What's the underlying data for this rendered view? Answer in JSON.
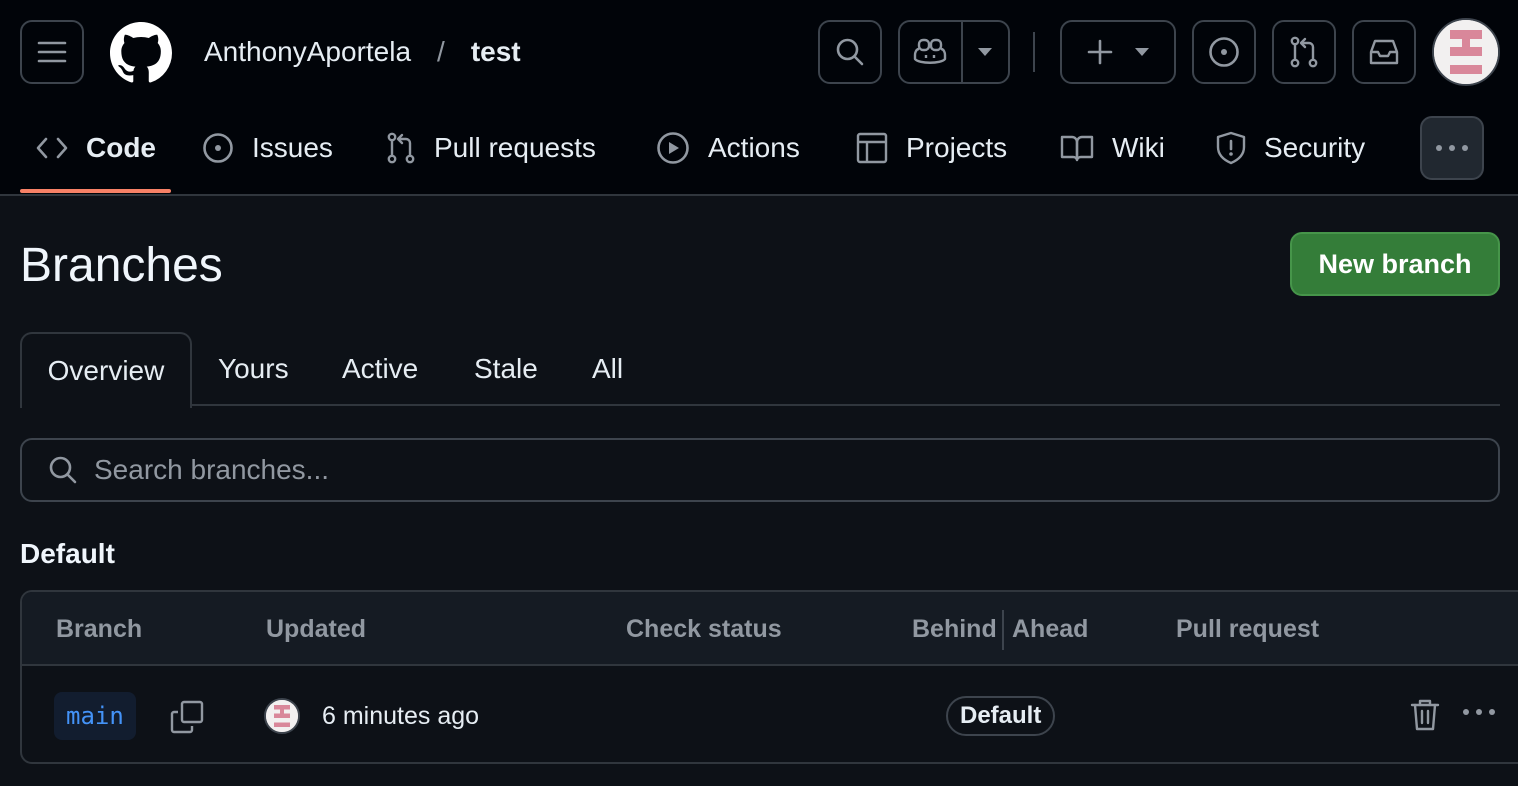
{
  "header": {
    "owner": "AnthonyAportela",
    "separator": "/",
    "repo": "test",
    "icons": [
      "hamburger-menu-icon",
      "github-logo-icon",
      "search-icon",
      "copilot-icon",
      "triangle-down-icon",
      "plus-icon",
      "issue-opened-icon",
      "git-pull-request-icon",
      "inbox-icon"
    ]
  },
  "nav": {
    "code": "Code",
    "issues": "Issues",
    "pull_requests": "Pull requests",
    "actions": "Actions",
    "projects": "Projects",
    "wiki": "Wiki",
    "security": "Security"
  },
  "main": {
    "title": "Branches",
    "new_branch": "New branch",
    "tabs": [
      "Overview",
      "Yours",
      "Active",
      "Stale",
      "All"
    ],
    "search_placeholder": "Search branches...",
    "section": "Default"
  },
  "table": {
    "columns": {
      "branch": "Branch",
      "updated": "Updated",
      "check_status": "Check status",
      "behind": "Behind",
      "ahead": "Ahead",
      "pull_request": "Pull request"
    },
    "rows": [
      {
        "branch": "main",
        "updated": "6 minutes ago",
        "badge": "Default"
      }
    ]
  },
  "colors": {
    "background": "#0d1117",
    "header_bg": "#010409",
    "accent_underline": "#f78166",
    "primary_button": "#347d39",
    "link": "#4493f8",
    "muted_text": "#9198a1",
    "border": "#30363d"
  }
}
